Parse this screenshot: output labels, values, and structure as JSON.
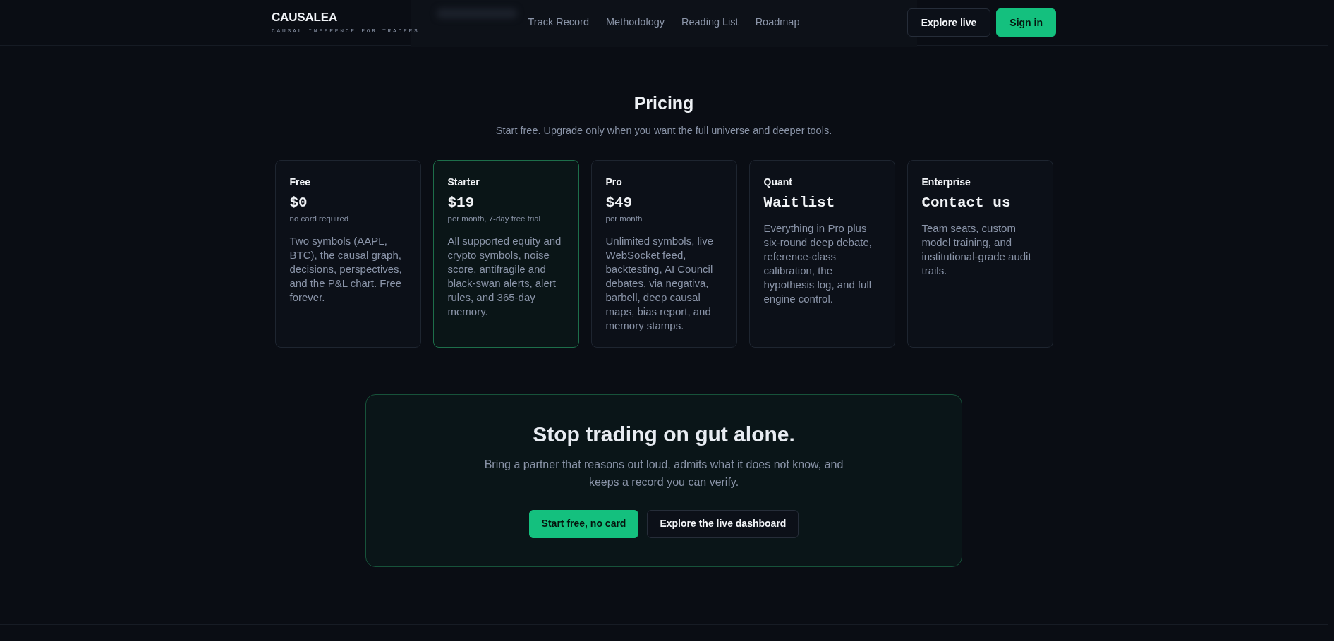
{
  "header": {
    "logo": "CAUSALEA",
    "tagline": "CAUSAL INFERENCE FOR TRADERS",
    "nav": [
      "Track Record",
      "Methodology",
      "Reading List",
      "Roadmap"
    ],
    "buttons": [
      {
        "label": "Explore live",
        "kind": "outline"
      },
      {
        "label": "Sign in",
        "kind": "primary"
      }
    ]
  },
  "pricing": {
    "title": "Pricing",
    "subtitle": "Start free. Upgrade only when you want the full universe and deeper tools.",
    "plans": [
      {
        "name": "Free",
        "price": "$0",
        "note": "no card required",
        "description": "Two symbols (AAPL, BTC), the causal graph, decisions, perspectives, and the P&L chart. Free forever.",
        "featured": false
      },
      {
        "name": "Starter",
        "price": "$19",
        "note": "per month, 7-day free trial",
        "description": "All supported equity and crypto symbols, noise score, antifragile and black-swan alerts, alert rules, and 365-day memory.",
        "featured": true
      },
      {
        "name": "Pro",
        "price": "$49",
        "note": "per month",
        "description": "Unlimited symbols, live WebSocket feed, backtesting, AI Council debates, via negativa, barbell, deep causal maps, bias report, and memory stamps.",
        "featured": false
      },
      {
        "name": "Quant",
        "price": "Waitlist",
        "description": "Everything in Pro plus six-round deep debate, reference-class calibration, the hypothesis log, and full engine control.",
        "featured": false
      },
      {
        "name": "Enterprise",
        "price": "Contact us",
        "description": "Team seats, custom model training, and institutional-grade audit trails.",
        "featured": false
      }
    ]
  },
  "cta": {
    "title": "Stop trading on gut alone.",
    "text": "Bring a partner that reasons out loud, admits what it does not know, and keeps a record you can verify.",
    "buttons": [
      {
        "label": "Start free, no card",
        "kind": "primary"
      },
      {
        "label": "Explore the live dashboard",
        "kind": "outline"
      }
    ]
  }
}
